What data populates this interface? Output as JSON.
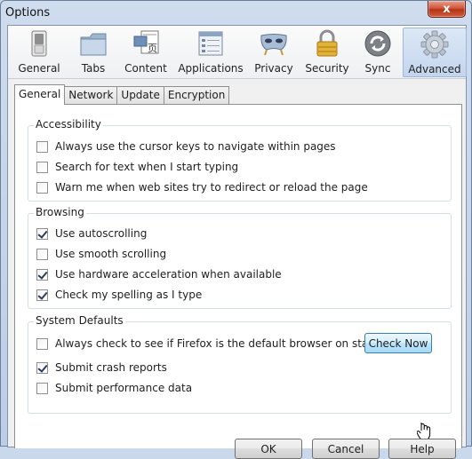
{
  "window": {
    "title": "Options",
    "close_glyph": "x"
  },
  "panes": [
    {
      "label": "General",
      "icon": "switch-icon",
      "selected": false
    },
    {
      "label": "Tabs",
      "icon": "tabs-folder-icon",
      "selected": false
    },
    {
      "label": "Content",
      "icon": "content-page-icon",
      "selected": false
    },
    {
      "label": "Applications",
      "icon": "applications-list-icon",
      "selected": false
    },
    {
      "label": "Privacy",
      "icon": "mask-icon",
      "selected": false
    },
    {
      "label": "Security",
      "icon": "padlock-icon",
      "selected": false
    },
    {
      "label": "Sync",
      "icon": "sync-icon",
      "selected": false
    },
    {
      "label": "Advanced",
      "icon": "gear-icon",
      "selected": true
    }
  ],
  "tabs": [
    {
      "label": "General",
      "active": true
    },
    {
      "label": "Network",
      "active": false
    },
    {
      "label": "Update",
      "active": false
    },
    {
      "label": "Encryption",
      "active": false
    }
  ],
  "accessibility": {
    "title": "Accessibility",
    "items": [
      {
        "label": "Always use the cursor keys to navigate within pages",
        "checked": false
      },
      {
        "label": "Search for text when I start typing",
        "checked": false
      },
      {
        "label": "Warn me when web sites try to redirect or reload the page",
        "checked": false
      }
    ]
  },
  "browsing": {
    "title": "Browsing",
    "items": [
      {
        "label": "Use autoscrolling",
        "checked": true
      },
      {
        "label": "Use smooth scrolling",
        "checked": false
      },
      {
        "label": "Use hardware acceleration when available",
        "checked": true
      },
      {
        "label": "Check my spelling as I type",
        "checked": true
      }
    ]
  },
  "system_defaults": {
    "title": "System Defaults",
    "items": [
      {
        "label": "Always check to see if Firefox is the default browser on startup",
        "checked": false
      },
      {
        "label": "Submit crash reports",
        "checked": true
      },
      {
        "label": "Submit performance data",
        "checked": false
      }
    ],
    "check_now_label": "Check Now"
  },
  "footer": {
    "ok_label": "OK",
    "cancel_label": "Cancel",
    "help_label": "Help"
  },
  "colors": {
    "selected_pane": "#c3d5ee",
    "hover_button": "#bee6fd",
    "close_button": "#c9452a"
  }
}
